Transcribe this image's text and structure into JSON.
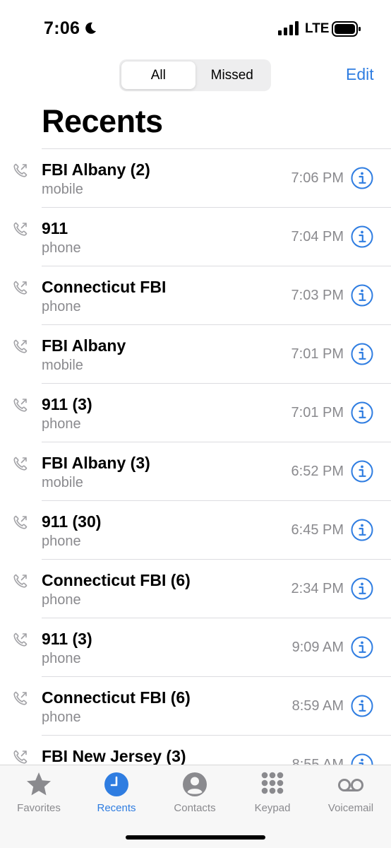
{
  "status_bar": {
    "time": "7:06",
    "network": "LTE"
  },
  "header": {
    "segments": [
      "All",
      "Missed"
    ],
    "active_segment": "All",
    "edit_label": "Edit",
    "title": "Recents"
  },
  "calls": [
    {
      "name": "FBI Albany (2)",
      "type": "mobile",
      "time": "7:06 PM"
    },
    {
      "name": "911",
      "type": "phone",
      "time": "7:04 PM"
    },
    {
      "name": "Connecticut FBI",
      "type": "phone",
      "time": "7:03 PM"
    },
    {
      "name": "FBI Albany",
      "type": "mobile",
      "time": "7:01 PM"
    },
    {
      "name": "911 (3)",
      "type": "phone",
      "time": "7:01 PM"
    },
    {
      "name": "FBI Albany (3)",
      "type": "mobile",
      "time": "6:52 PM"
    },
    {
      "name": "911 (30)",
      "type": "phone",
      "time": "6:45 PM"
    },
    {
      "name": "Connecticut FBI (6)",
      "type": "phone",
      "time": "2:34 PM"
    },
    {
      "name": "911 (3)",
      "type": "phone",
      "time": "9:09 AM"
    },
    {
      "name": "Connecticut FBI (6)",
      "type": "phone",
      "time": "8:59 AM"
    },
    {
      "name": "FBI New Jersey (3)",
      "type": "",
      "time": "8:55 AM"
    }
  ],
  "tab_bar": {
    "tabs": [
      {
        "label": "Favorites",
        "icon": "star-icon"
      },
      {
        "label": "Recents",
        "icon": "clock-icon"
      },
      {
        "label": "Contacts",
        "icon": "person-icon"
      },
      {
        "label": "Keypad",
        "icon": "keypad-icon"
      },
      {
        "label": "Voicemail",
        "icon": "voicemail-icon"
      }
    ],
    "active_tab": "Recents"
  },
  "colors": {
    "accent": "#2f7de1",
    "secondary_text": "#8a8a8e",
    "tab_inactive": "#8a8a8e"
  }
}
